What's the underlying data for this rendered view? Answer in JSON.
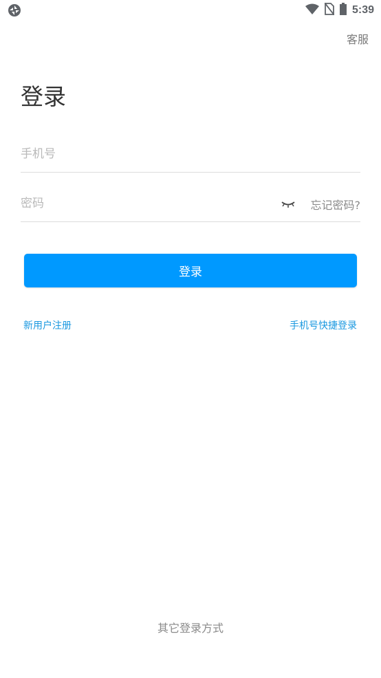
{
  "status_bar": {
    "time": "5:39",
    "left_icon": "app-notification-icon",
    "icons": [
      "wifi-icon",
      "no-sim-icon",
      "battery-icon"
    ]
  },
  "header": {
    "service_label": "客服"
  },
  "title": "登录",
  "form": {
    "phone_placeholder": "手机号",
    "password_placeholder": "密码",
    "password_toggle_icon": "eye-closed-icon",
    "forgot_label": "忘记密码?"
  },
  "login_button_label": "登录",
  "links": {
    "register": "新用户注册",
    "quick_login": "手机号快捷登录"
  },
  "footer": {
    "other_login": "其它登录方式"
  },
  "colors": {
    "accent": "#0099ff",
    "link": "#1a98e0",
    "muted": "#8a8a8a"
  }
}
